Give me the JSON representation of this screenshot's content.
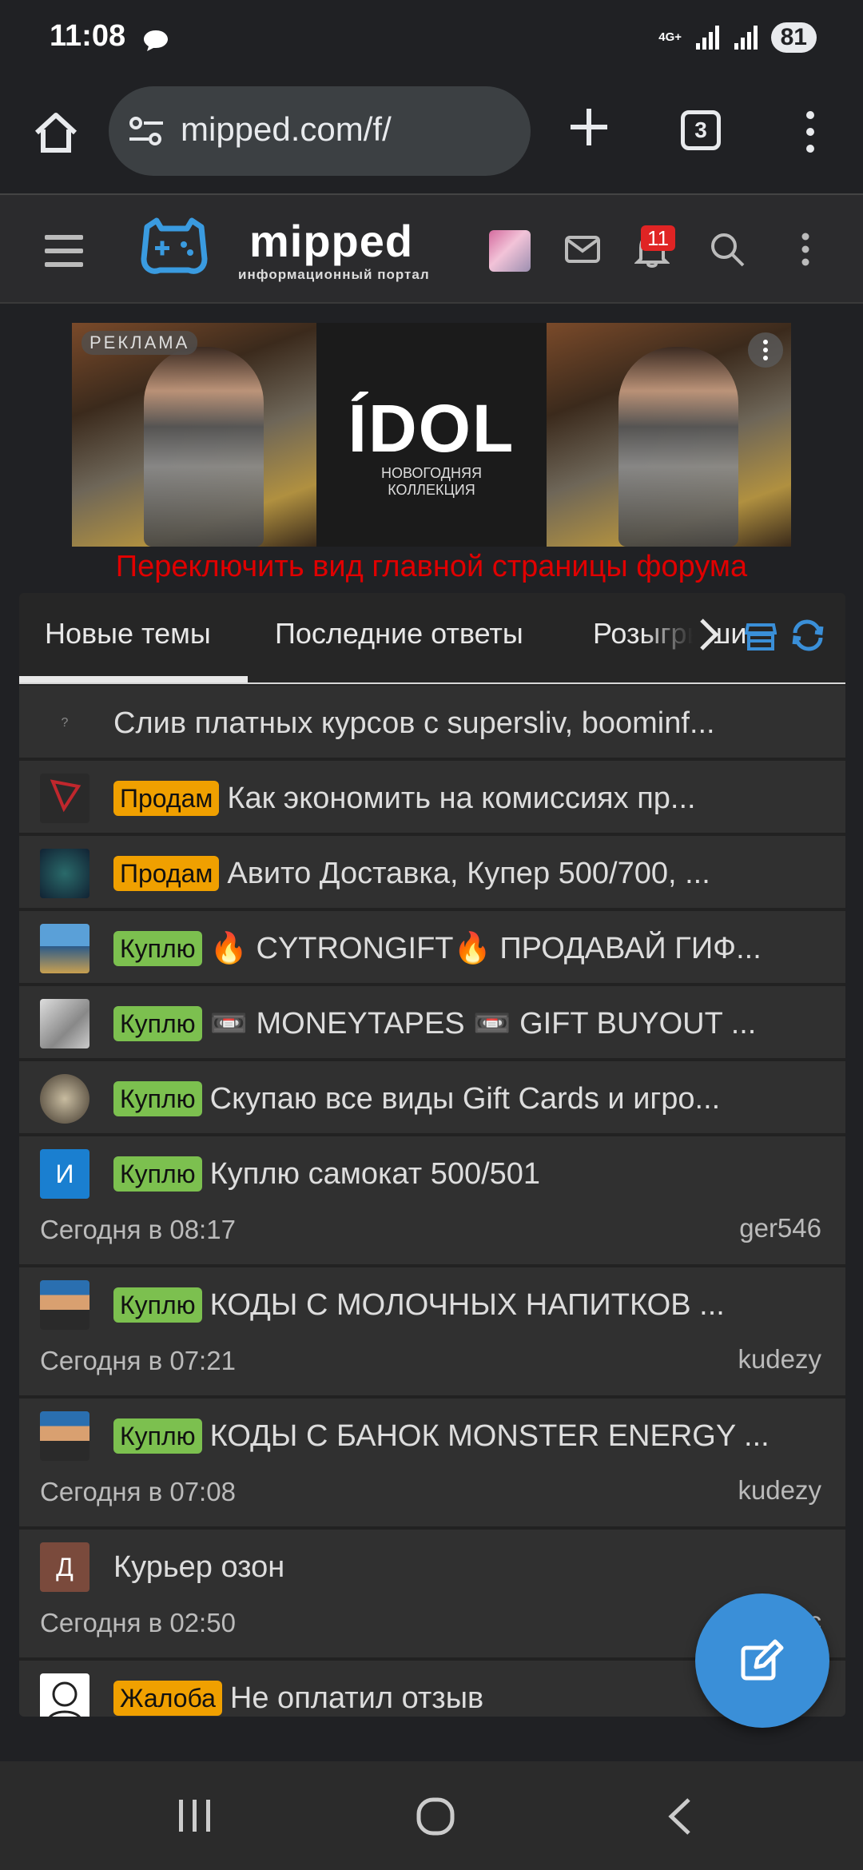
{
  "status_bar": {
    "time": "11:08",
    "network": "4G+",
    "battery": "81"
  },
  "browser": {
    "url": "mipped.com/f/",
    "tab_count": "3"
  },
  "site": {
    "logo_title": "mipped",
    "logo_subtitle": "информационный портал",
    "notifications_count": "11"
  },
  "ad": {
    "label": "РЕКЛАМА",
    "brand": "ÍDOL",
    "tagline": "НОВОГОДНЯЯ КОЛЛЕКЦИЯ"
  },
  "switch_view_link": "Переключить вид главной страницы форума",
  "tabs": [
    "Новые темы",
    "Последние ответы",
    "Розыгрыши"
  ],
  "threads": [
    {
      "avatar": "?",
      "prefix": "",
      "title": "Слив платных курсов с supersliv, boominf..."
    },
    {
      "avatar": "",
      "prefix": "Продам",
      "title": "Как экономить на комиссиях пр..."
    },
    {
      "avatar": "",
      "prefix": "Продам",
      "title": "Авито Доставка, Купер 500/700, ..."
    },
    {
      "avatar": "",
      "prefix": "Куплю",
      "title": "🔥 CYTRONGIFT🔥 ПРОДАВАЙ ГИФ..."
    },
    {
      "avatar": "",
      "prefix": "Куплю",
      "title": "📼 MONEYTAPES 📼 GIFT BUYOUT ..."
    },
    {
      "avatar": "",
      "prefix": "Куплю",
      "title": "Скупаю все виды Gift Cards и игро..."
    },
    {
      "avatar": "И",
      "prefix": "Куплю",
      "title": "Куплю самокат 500/501",
      "date": "Сегодня в 08:17",
      "user": "ger546"
    },
    {
      "avatar": "",
      "prefix": "Куплю",
      "title": "КОДЫ С МОЛОЧНЫХ НАПИТКОВ ...",
      "date": "Сегодня в 07:21",
      "user": "kudezy"
    },
    {
      "avatar": "",
      "prefix": "Куплю",
      "title": "КОДЫ С БАНОК MONSTER ENERGY ...",
      "date": "Сегодня в 07:08",
      "user": "kudezy"
    },
    {
      "avatar": "Д",
      "prefix": "",
      "title": "Курьер озон",
      "date": "Сегодня в 02:50",
      "user": "c"
    },
    {
      "avatar": "",
      "prefix": "Жалоба",
      "title": "Не оплатил отзыв"
    }
  ],
  "colors": {
    "accent": "#3a8fd8",
    "prefix_sell": "#f0a000",
    "prefix_buy": "#7cc04f",
    "link_red": "#e00000",
    "badge": "#e02424"
  },
  "icons": [
    "home-icon",
    "tune-icon",
    "plus-icon",
    "more-vert-icon",
    "menu-icon",
    "mail-icon",
    "bell-icon",
    "search-icon",
    "chevron-right-icon",
    "store-icon",
    "refresh-icon",
    "edit-icon",
    "recent-apps-icon",
    "home-nav-icon",
    "back-icon"
  ]
}
